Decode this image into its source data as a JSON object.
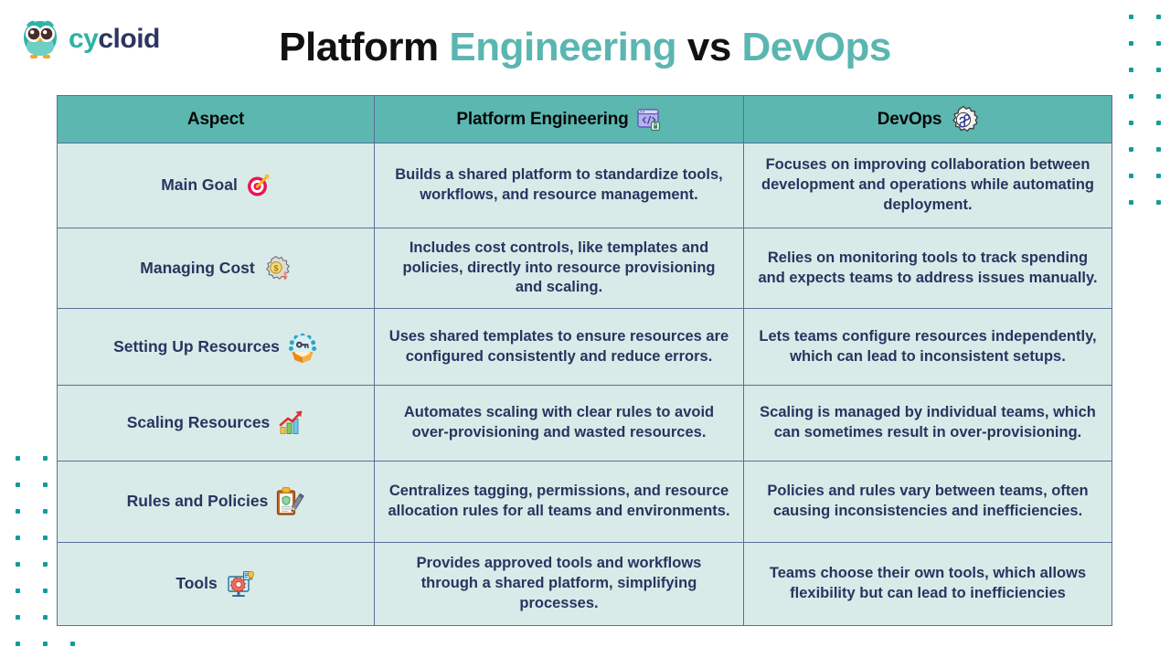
{
  "brand": {
    "logo_icon": "owl-icon",
    "name_part1": "cy",
    "name_part2": "cloid"
  },
  "title": {
    "word1": "Platform ",
    "word2": "Engineering",
    "word3": " vs ",
    "word4": "DevOps"
  },
  "colors": {
    "teal_accent": "#5ab6b1",
    "header_bg": "#5cb7b0",
    "cell_bg": "#d8ebe8",
    "border": "#5a6f9b",
    "body_text": "#2b3361",
    "logo_teal": "#2cb3a6",
    "logo_navy": "#2d3561",
    "dot": "#169b9b"
  },
  "table": {
    "headers": [
      {
        "label": "Aspect",
        "icon": ""
      },
      {
        "label": "Platform Engineering",
        "icon": "code-window-icon",
        "glyph": "🖥️"
      },
      {
        "label": "DevOps",
        "icon": "gear-infinity-icon",
        "glyph": "⚙️"
      }
    ],
    "rows": [
      {
        "aspect": "Main Goal",
        "aspect_icon": "target-dart-icon",
        "aspect_glyph": "🎯",
        "platform_engineering": "Builds a shared platform to standardize tools, workflows, and resource management.",
        "devops": "Focuses on improving collaboration between development and operations while automating deployment."
      },
      {
        "aspect": "Managing Cost",
        "aspect_icon": "gear-coin-icon",
        "aspect_glyph": "⚙️",
        "platform_engineering": "Includes cost controls, like templates and policies, directly into resource provisioning and scaling.",
        "devops": "Relies on monitoring tools to track spending and expects teams to address issues manually."
      },
      {
        "aspect": "Setting Up Resources",
        "aspect_icon": "key-box-icon",
        "aspect_glyph": "📦",
        "platform_engineering": "Uses shared templates to ensure resources are configured consistently and reduce errors.",
        "devops": "Lets teams configure resources independently, which can lead to inconsistent setups."
      },
      {
        "aspect": "Scaling Resources",
        "aspect_icon": "bar-chart-up-icon",
        "aspect_glyph": "📈",
        "platform_engineering": "Automates scaling with clear rules to avoid over-provisioning and wasted resources.",
        "devops": "Scaling is managed by individual teams, which can sometimes result in over-provisioning."
      },
      {
        "aspect": "Rules and Policies",
        "aspect_icon": "clipboard-pencil-icon",
        "aspect_glyph": "📋",
        "platform_engineering": "Centralizes tagging, permissions, and resource allocation rules for all teams and environments.",
        "devops": "Policies and rules vary between teams, often causing inconsistencies and inefficiencies."
      },
      {
        "aspect": "Tools",
        "aspect_icon": "monitor-gear-icon",
        "aspect_glyph": "🖥️",
        "platform_engineering": "Provides approved tools and workflows through a shared platform, simplifying processes.",
        "devops": "Teams choose their own tools, which allows flexibility but can lead to inefficiencies"
      }
    ]
  }
}
